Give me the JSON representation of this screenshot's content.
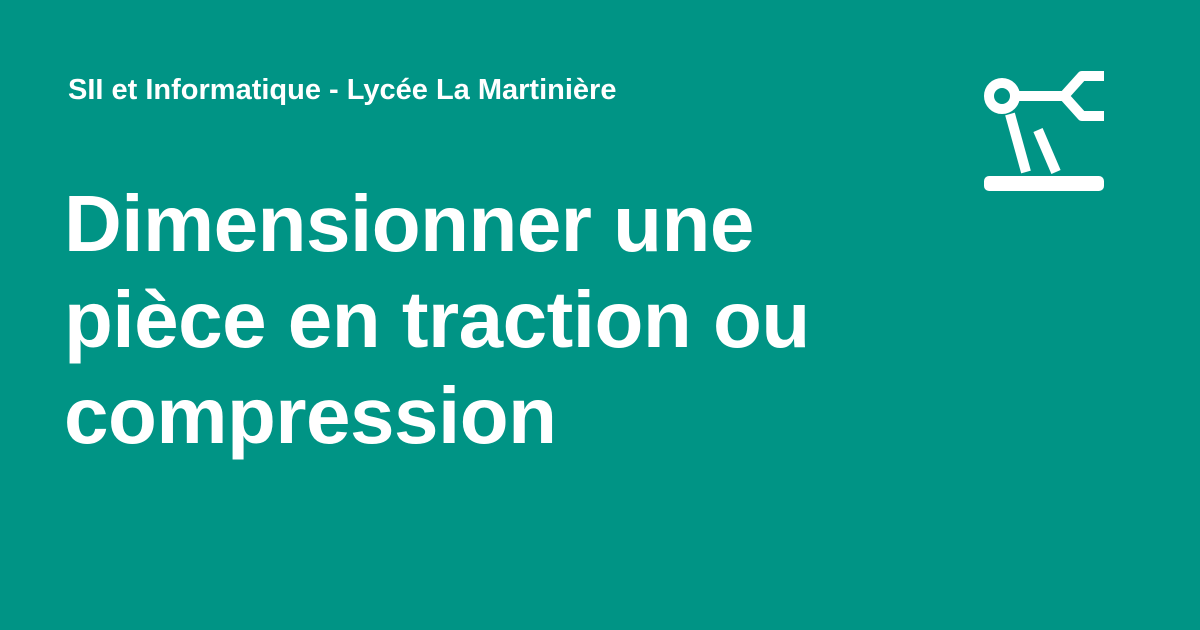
{
  "header": {
    "site_name": "SII et Informatique - Lycée La Martinière"
  },
  "main": {
    "title_lines": [
      "Dimensionner une",
      "pièce en traction ou",
      "compression"
    ]
  },
  "logo": {
    "icon": "robot-arm-icon"
  },
  "colors": {
    "background": "#009485",
    "text": "#ffffff"
  }
}
